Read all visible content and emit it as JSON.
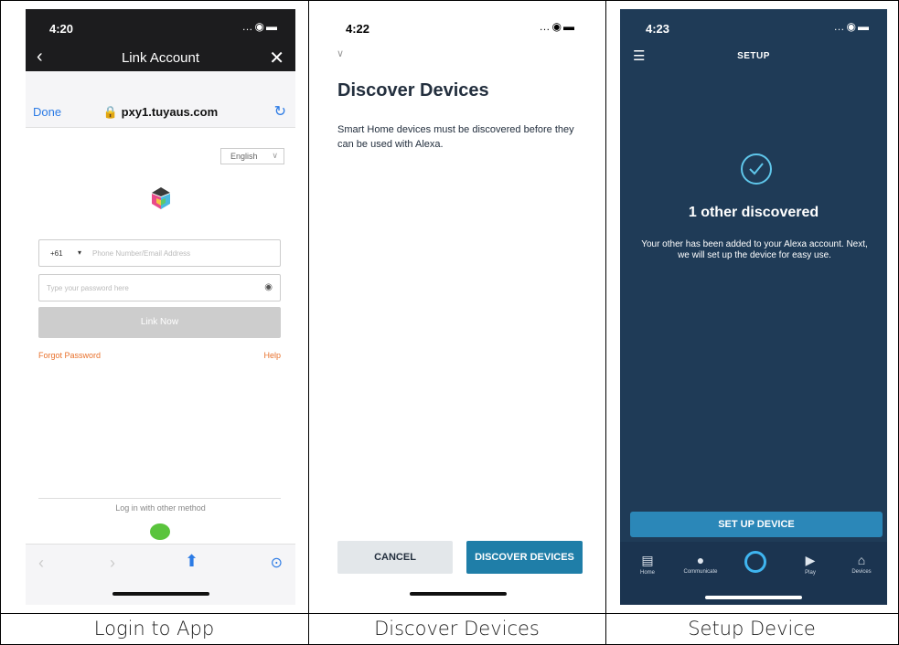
{
  "captions": [
    "Login to App",
    "Discover Devices",
    "Setup Device"
  ],
  "phone1": {
    "time": "4:20",
    "status_icons": "…◉▬",
    "nav_title": "Link Account",
    "back_glyph": "‹",
    "close_glyph": "✕",
    "done": "Done",
    "url": "🔒 pxy1.tuyaus.com",
    "reload_glyph": "↻",
    "language": "English",
    "language_chevron": "∨",
    "country_code": "+61",
    "dropdown_glyph": "▾",
    "phone_placeholder": "Phone Number/Email Address",
    "password_placeholder": "Type your password here",
    "eye_glyph": "◉",
    "link_now": "Link Now",
    "forgot": "Forgot Password",
    "help": "Help",
    "other_method": "Log in with other method",
    "toolbar": {
      "back": "‹",
      "forward": "›",
      "share": "⬆",
      "compass": "⊙"
    }
  },
  "phone2": {
    "time": "4:22",
    "status_icons": "…◉▬",
    "chevron": "∨",
    "title": "Discover Devices",
    "body": "Smart Home devices must be discovered before they can be used with Alexa.",
    "cancel": "CANCEL",
    "discover": "DISCOVER DEVICES"
  },
  "phone3": {
    "time": "4:23",
    "status_icons": "…◉▬",
    "menu_glyph": "☰",
    "title": "SETUP",
    "heading": "1 other discovered",
    "body": "Your other has been added to your Alexa account. Next, we will set up the device for easy use.",
    "button": "SET UP DEVICE",
    "tabs": [
      {
        "label": "Home",
        "icon": "▤"
      },
      {
        "label": "Communicate",
        "icon": "●"
      },
      {
        "label": "Play",
        "icon": "▶"
      },
      {
        "label": "Devices",
        "icon": "⌂"
      }
    ],
    "colors": {
      "background": "#1f3b57",
      "accent": "#2b87b8",
      "alexa_ring": "#3fb5f0"
    }
  }
}
